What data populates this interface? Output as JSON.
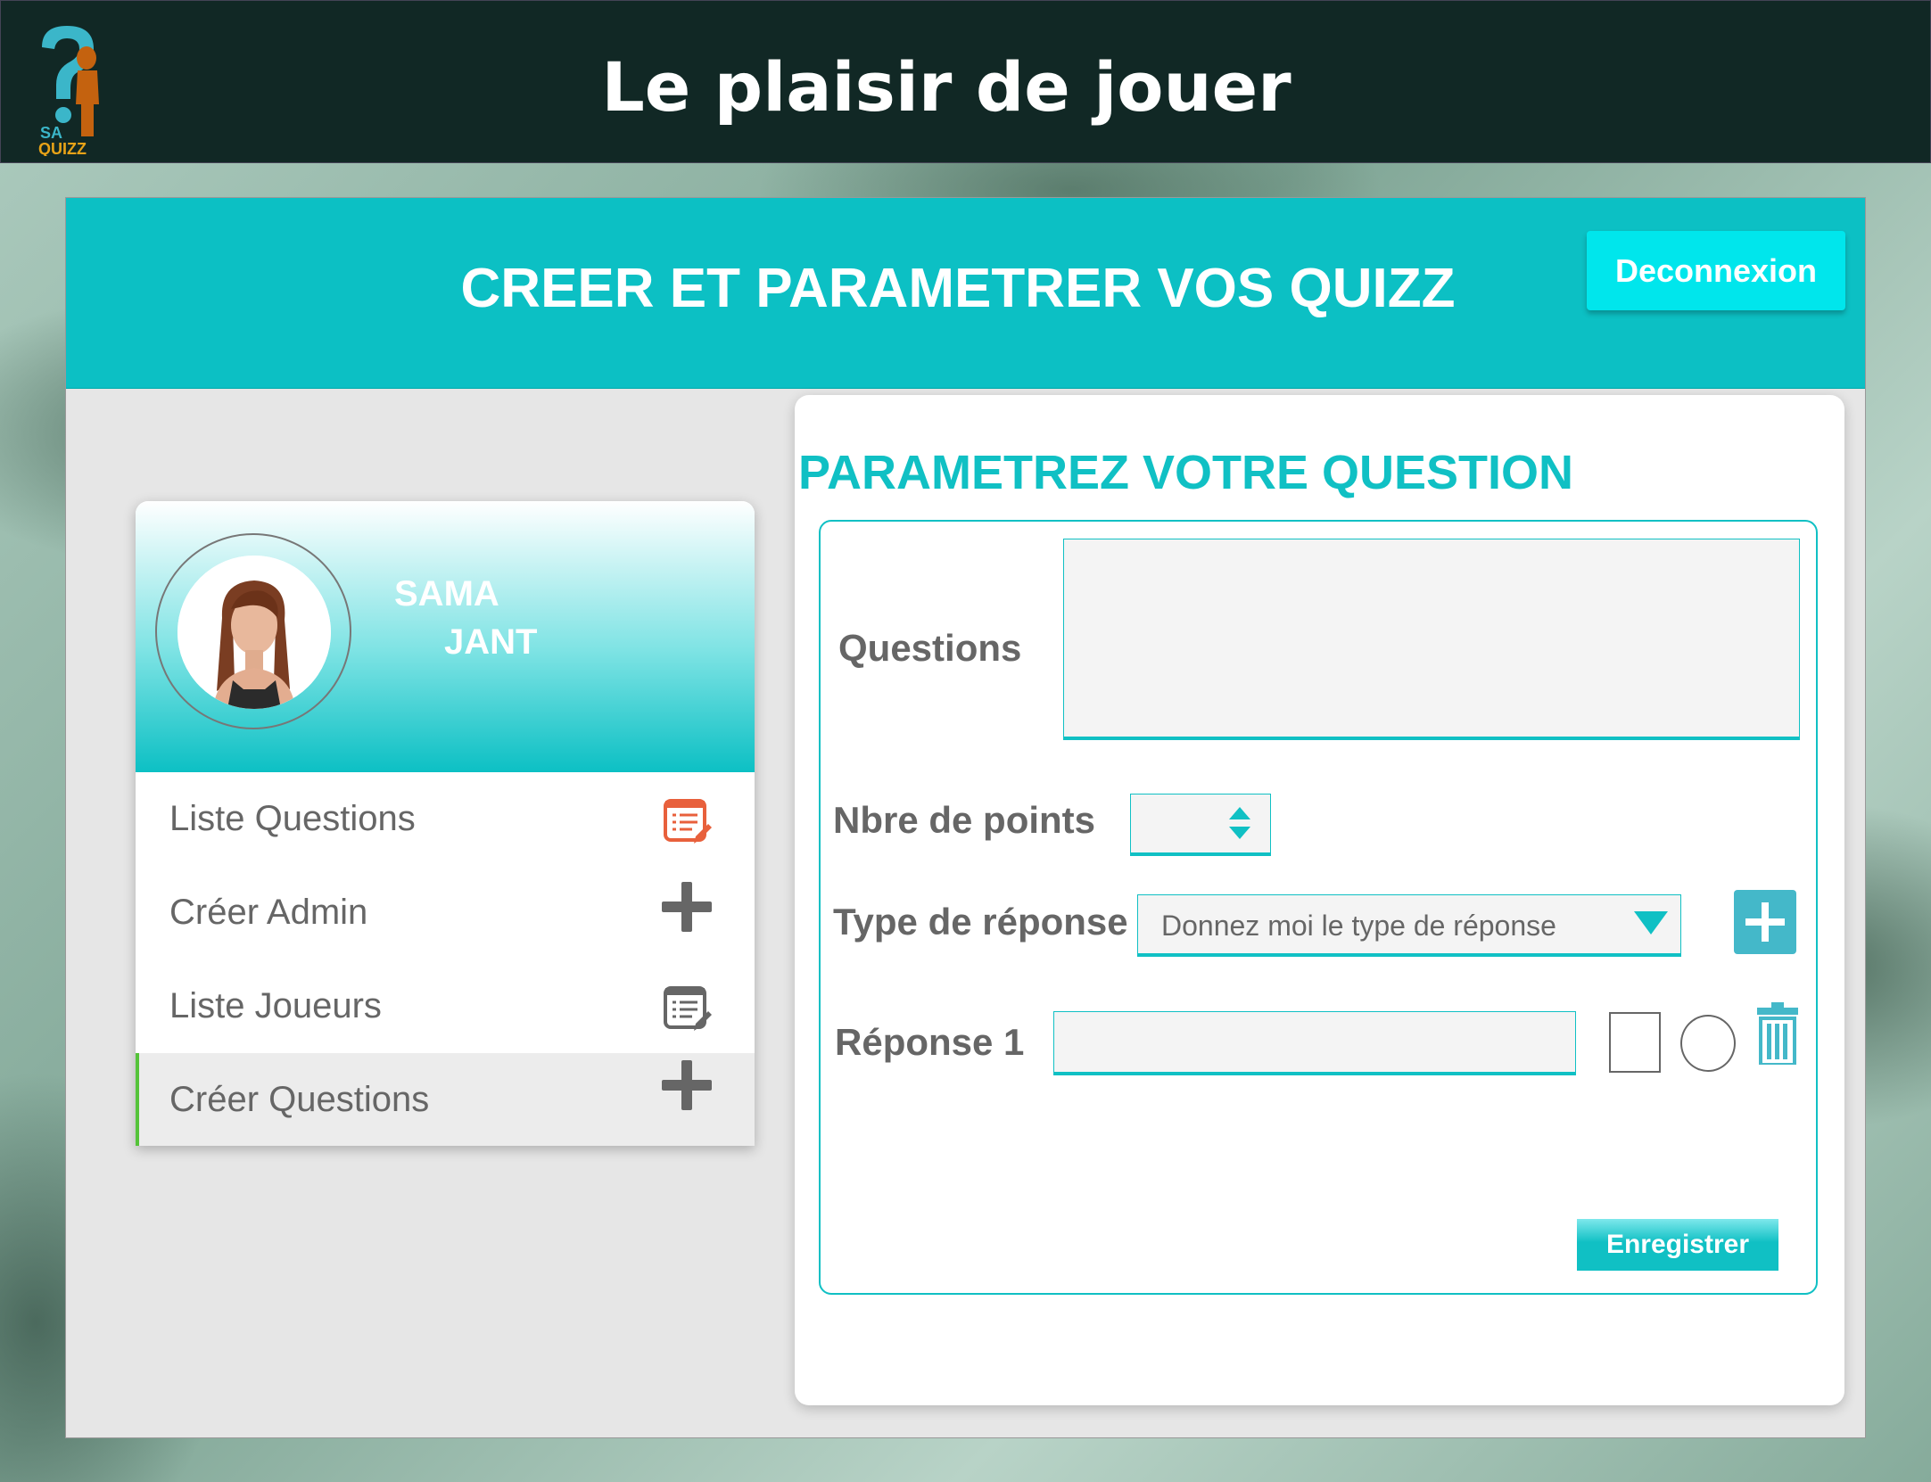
{
  "app": {
    "logo_text_1": "SA",
    "logo_text_2": "QUIZZ",
    "site_title": "Le plaisir de jouer"
  },
  "header": {
    "title": "CREER ET PARAMETRER VOS QUIZZ",
    "logout_label": "Deconnexion"
  },
  "profile": {
    "first_name": "SAMA",
    "last_name": "JANT"
  },
  "sidebar": {
    "items": [
      {
        "label": "Liste Questions",
        "icon": "edit-list-icon"
      },
      {
        "label": "Créer Admin",
        "icon": "plus-icon"
      },
      {
        "label": "Liste Joueurs",
        "icon": "edit-list-icon"
      },
      {
        "label": "Créer Questions",
        "icon": "plus-icon",
        "active": true
      }
    ]
  },
  "form": {
    "title": "PARAMETREZ VOTRE QUESTION",
    "question_label": "Questions",
    "question_value": "",
    "points_label": "Nbre de points",
    "points_value": "",
    "type_label": "Type de réponse",
    "type_placeholder": "Donnez moi le type de réponse",
    "answer_label": "Réponse 1",
    "answer_value": "",
    "save_label": "Enregistrer"
  },
  "colors": {
    "accent": "#0cc0c4",
    "topbar": "#112825",
    "logout_bg": "#00e6ec",
    "active_marker": "#55c33a",
    "plus_button": "#44b8c9"
  }
}
